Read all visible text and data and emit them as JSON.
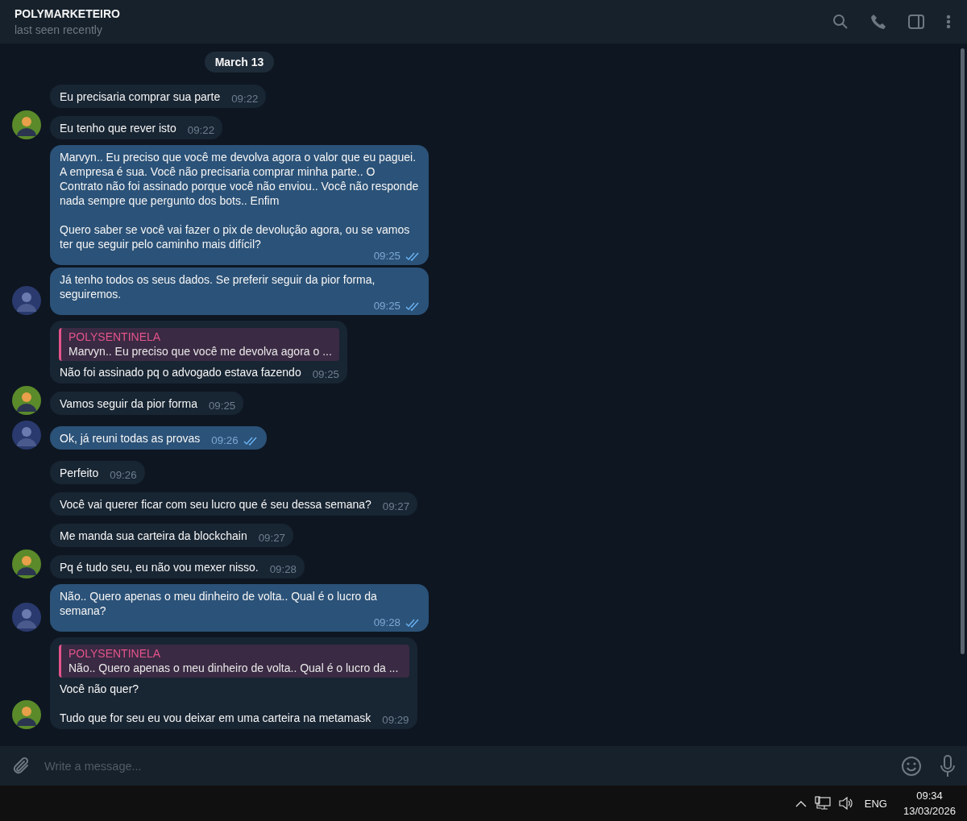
{
  "header": {
    "title": "POLYMARKETEIRO",
    "status": "last seen recently"
  },
  "date": "March 13",
  "messages": [
    {
      "kind": "incoming",
      "text": "Eu precisaria comprar sua parte",
      "time": "09:22"
    },
    {
      "kind": "incoming",
      "text": "Eu tenho que rever isto",
      "time": "09:22"
    },
    {
      "kind": "outgoing",
      "text": "Marvyn.. Eu preciso que você me devolva agora o valor que eu paguei. A empresa é sua. Você não precisaria comprar minha parte.. O Contrato não foi assinado porque você não enviou.. Você não responde nada sempre que pergunto dos bots.. Enfim\n\nQuero saber se você vai fazer o pix de devolução agora, ou se vamos ter que seguir pelo caminho mais difícil?",
      "time": "09:25",
      "read": true
    },
    {
      "kind": "outgoing",
      "text": "Já tenho todos os seus dados. Se preferir seguir da pior forma, seguiremos.",
      "time": "09:25",
      "read": true
    },
    {
      "kind": "incoming",
      "reply": {
        "name": "POLYSENTINELA",
        "text": "Marvyn.. Eu preciso que você me devolva agora o ..."
      },
      "text": "Não foi assinado pq o advogado estava fazendo",
      "time": "09:25"
    },
    {
      "kind": "incoming",
      "text": "Vamos seguir da pior forma",
      "time": "09:25"
    },
    {
      "kind": "outgoing",
      "text": "Ok, já reuni todas as provas",
      "time": "09:26",
      "read": true
    },
    {
      "kind": "incoming",
      "text": "Perfeito",
      "time": "09:26"
    },
    {
      "kind": "incoming",
      "text": "Você vai querer ficar com seu lucro que é seu dessa semana?",
      "time": "09:27"
    },
    {
      "kind": "incoming",
      "text": "Me manda sua carteira da blockchain",
      "time": "09:27"
    },
    {
      "kind": "incoming",
      "text": "Pq é tudo seu, eu não vou mexer nisso.",
      "time": "09:28"
    },
    {
      "kind": "outgoing",
      "text": "Não.. Quero apenas o meu dinheiro de volta.. Qual é o lucro da semana?",
      "time": "09:28",
      "read": true
    },
    {
      "kind": "incoming",
      "reply": {
        "name": "POLYSENTINELA",
        "text": "Não.. Quero apenas o meu dinheiro de volta.. Qual é o lucro da ..."
      },
      "text": "Você não quer?\n\nTudo que for seu eu vou deixar em uma carteira na metamask",
      "time": "09:29"
    }
  ],
  "composer": {
    "placeholder": "Write a message..."
  },
  "taskbar": {
    "language": "ENG",
    "time": "09:34",
    "date": "13/03/2026"
  }
}
